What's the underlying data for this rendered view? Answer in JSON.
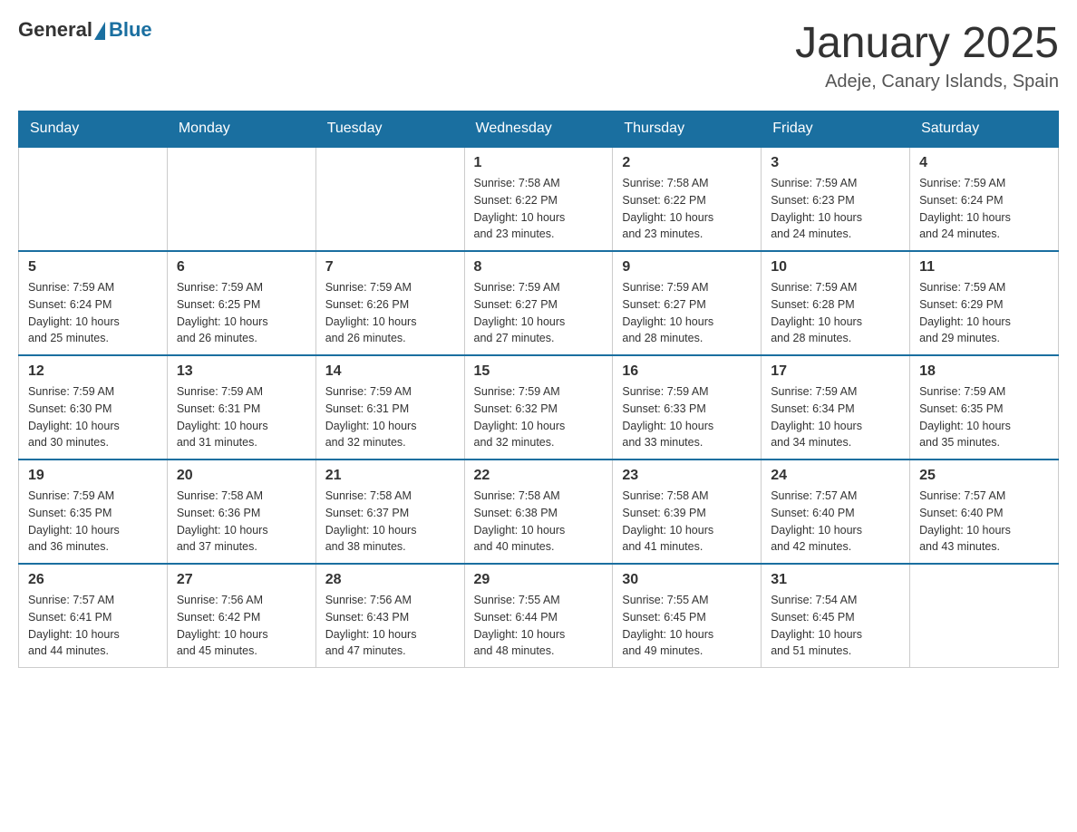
{
  "header": {
    "logo_general": "General",
    "logo_blue": "Blue",
    "month_title": "January 2025",
    "location": "Adeje, Canary Islands, Spain"
  },
  "days_of_week": [
    "Sunday",
    "Monday",
    "Tuesday",
    "Wednesday",
    "Thursday",
    "Friday",
    "Saturday"
  ],
  "weeks": [
    {
      "days": [
        {
          "number": "",
          "info": ""
        },
        {
          "number": "",
          "info": ""
        },
        {
          "number": "",
          "info": ""
        },
        {
          "number": "1",
          "info": "Sunrise: 7:58 AM\nSunset: 6:22 PM\nDaylight: 10 hours\nand 23 minutes."
        },
        {
          "number": "2",
          "info": "Sunrise: 7:58 AM\nSunset: 6:22 PM\nDaylight: 10 hours\nand 23 minutes."
        },
        {
          "number": "3",
          "info": "Sunrise: 7:59 AM\nSunset: 6:23 PM\nDaylight: 10 hours\nand 24 minutes."
        },
        {
          "number": "4",
          "info": "Sunrise: 7:59 AM\nSunset: 6:24 PM\nDaylight: 10 hours\nand 24 minutes."
        }
      ]
    },
    {
      "days": [
        {
          "number": "5",
          "info": "Sunrise: 7:59 AM\nSunset: 6:24 PM\nDaylight: 10 hours\nand 25 minutes."
        },
        {
          "number": "6",
          "info": "Sunrise: 7:59 AM\nSunset: 6:25 PM\nDaylight: 10 hours\nand 26 minutes."
        },
        {
          "number": "7",
          "info": "Sunrise: 7:59 AM\nSunset: 6:26 PM\nDaylight: 10 hours\nand 26 minutes."
        },
        {
          "number": "8",
          "info": "Sunrise: 7:59 AM\nSunset: 6:27 PM\nDaylight: 10 hours\nand 27 minutes."
        },
        {
          "number": "9",
          "info": "Sunrise: 7:59 AM\nSunset: 6:27 PM\nDaylight: 10 hours\nand 28 minutes."
        },
        {
          "number": "10",
          "info": "Sunrise: 7:59 AM\nSunset: 6:28 PM\nDaylight: 10 hours\nand 28 minutes."
        },
        {
          "number": "11",
          "info": "Sunrise: 7:59 AM\nSunset: 6:29 PM\nDaylight: 10 hours\nand 29 minutes."
        }
      ]
    },
    {
      "days": [
        {
          "number": "12",
          "info": "Sunrise: 7:59 AM\nSunset: 6:30 PM\nDaylight: 10 hours\nand 30 minutes."
        },
        {
          "number": "13",
          "info": "Sunrise: 7:59 AM\nSunset: 6:31 PM\nDaylight: 10 hours\nand 31 minutes."
        },
        {
          "number": "14",
          "info": "Sunrise: 7:59 AM\nSunset: 6:31 PM\nDaylight: 10 hours\nand 32 minutes."
        },
        {
          "number": "15",
          "info": "Sunrise: 7:59 AM\nSunset: 6:32 PM\nDaylight: 10 hours\nand 32 minutes."
        },
        {
          "number": "16",
          "info": "Sunrise: 7:59 AM\nSunset: 6:33 PM\nDaylight: 10 hours\nand 33 minutes."
        },
        {
          "number": "17",
          "info": "Sunrise: 7:59 AM\nSunset: 6:34 PM\nDaylight: 10 hours\nand 34 minutes."
        },
        {
          "number": "18",
          "info": "Sunrise: 7:59 AM\nSunset: 6:35 PM\nDaylight: 10 hours\nand 35 minutes."
        }
      ]
    },
    {
      "days": [
        {
          "number": "19",
          "info": "Sunrise: 7:59 AM\nSunset: 6:35 PM\nDaylight: 10 hours\nand 36 minutes."
        },
        {
          "number": "20",
          "info": "Sunrise: 7:58 AM\nSunset: 6:36 PM\nDaylight: 10 hours\nand 37 minutes."
        },
        {
          "number": "21",
          "info": "Sunrise: 7:58 AM\nSunset: 6:37 PM\nDaylight: 10 hours\nand 38 minutes."
        },
        {
          "number": "22",
          "info": "Sunrise: 7:58 AM\nSunset: 6:38 PM\nDaylight: 10 hours\nand 40 minutes."
        },
        {
          "number": "23",
          "info": "Sunrise: 7:58 AM\nSunset: 6:39 PM\nDaylight: 10 hours\nand 41 minutes."
        },
        {
          "number": "24",
          "info": "Sunrise: 7:57 AM\nSunset: 6:40 PM\nDaylight: 10 hours\nand 42 minutes."
        },
        {
          "number": "25",
          "info": "Sunrise: 7:57 AM\nSunset: 6:40 PM\nDaylight: 10 hours\nand 43 minutes."
        }
      ]
    },
    {
      "days": [
        {
          "number": "26",
          "info": "Sunrise: 7:57 AM\nSunset: 6:41 PM\nDaylight: 10 hours\nand 44 minutes."
        },
        {
          "number": "27",
          "info": "Sunrise: 7:56 AM\nSunset: 6:42 PM\nDaylight: 10 hours\nand 45 minutes."
        },
        {
          "number": "28",
          "info": "Sunrise: 7:56 AM\nSunset: 6:43 PM\nDaylight: 10 hours\nand 47 minutes."
        },
        {
          "number": "29",
          "info": "Sunrise: 7:55 AM\nSunset: 6:44 PM\nDaylight: 10 hours\nand 48 minutes."
        },
        {
          "number": "30",
          "info": "Sunrise: 7:55 AM\nSunset: 6:45 PM\nDaylight: 10 hours\nand 49 minutes."
        },
        {
          "number": "31",
          "info": "Sunrise: 7:54 AM\nSunset: 6:45 PM\nDaylight: 10 hours\nand 51 minutes."
        },
        {
          "number": "",
          "info": ""
        }
      ]
    }
  ]
}
